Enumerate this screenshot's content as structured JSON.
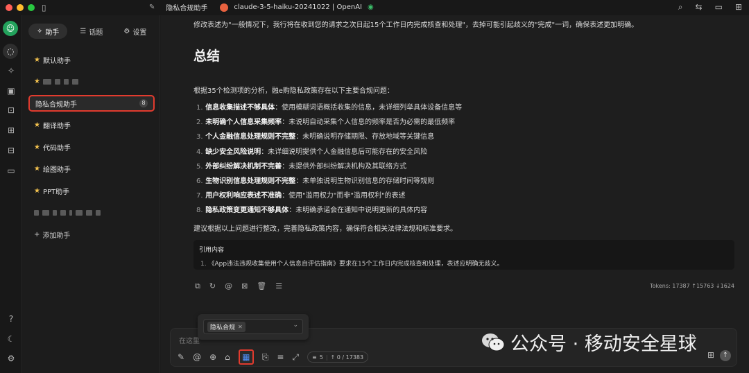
{
  "titlebar": {
    "assistant_name": "隐私合规助手",
    "model_label": "claude-3-5-haiku-20241022 | OpenAI"
  },
  "sidebar": {
    "tabs": [
      {
        "label": "助手",
        "icon": "sparkle-icon"
      },
      {
        "label": "话题",
        "icon": "list-icon"
      },
      {
        "label": "设置",
        "icon": "gear-icon"
      }
    ],
    "assistants": [
      {
        "label": "默认助手",
        "starred": true
      },
      {
        "label": "",
        "starred": true,
        "redacted": true
      },
      {
        "label": "隐私合规助手",
        "starred": false,
        "selected": true,
        "count": "8"
      },
      {
        "label": "翻译助手",
        "starred": true
      },
      {
        "label": "代码助手",
        "starred": true
      },
      {
        "label": "绘图助手",
        "starred": true
      },
      {
        "label": "PPT助手",
        "starred": true
      },
      {
        "label": "",
        "starred": false,
        "redacted": true
      }
    ],
    "add_label": "添加助手"
  },
  "message": {
    "intro": "修改表述为\"一般情况下，我行将在收到您的请求之次日起15个工作日内完成核查和处理\"，去掉可能引起歧义的\"完成\"一词，确保表述更加明确。",
    "heading": "总结",
    "lead": "根据35个检测项的分析，融e购隐私政策存在以下主要合规问题：",
    "issues": [
      {
        "num": "1.",
        "bold": "信息收集描述不够具体",
        "text": "：使用模糊词语概括收集的信息，未详细列举具体设备信息等"
      },
      {
        "num": "2.",
        "bold": "未明确个人信息采集频率",
        "text": "：未说明自动采集个人信息的频率是否为必需的最低频率"
      },
      {
        "num": "3.",
        "bold": "个人金融信息处理规则不完整",
        "text": "：未明确说明存储期限、存放地域等关键信息"
      },
      {
        "num": "4.",
        "bold": "缺少安全风险说明",
        "text": "：未详细说明提供个人金融信息后可能存在的安全风险"
      },
      {
        "num": "5.",
        "bold": "外部纠纷解决机制不完善",
        "text": "：未提供外部纠纷解决机构及其联络方式"
      },
      {
        "num": "6.",
        "bold": "生物识别信息处理规则不完整",
        "text": "：未单独说明生物识别信息的存储时间等规则"
      },
      {
        "num": "7.",
        "bold": "用户权利响应表述不准确",
        "text": "：使用\"滥用权力\"而非\"滥用权利\"的表述"
      },
      {
        "num": "8.",
        "bold": "隐私政策变更通知不够具体",
        "text": "：未明确承诺会在通知中说明更新的具体内容"
      }
    ],
    "suggestion": "建议根据以上问题进行整改，完善隐私政策内容，确保符合相关法律法规和标准要求。",
    "quote_title": "引用内容",
    "quote_num": "1.",
    "quote_text": "《App违法违规收集使用个人信息自评估指南》要求在15个工作日内完成核查和处理，表述应明确无歧义。",
    "tokens": "Tokens: 17387 ↑15763 ↓1624"
  },
  "input": {
    "placeholder": "在这里",
    "context_count": "5",
    "token_counter": "↑ 0 / 17383"
  },
  "popup": {
    "tag": "隐私合规"
  },
  "watermark": {
    "text": "公众号 · 移动安全星球"
  },
  "colors": {
    "accent_red": "#e23b2e",
    "brand_green": "#23a25c",
    "star_yellow": "#f2c14e"
  }
}
